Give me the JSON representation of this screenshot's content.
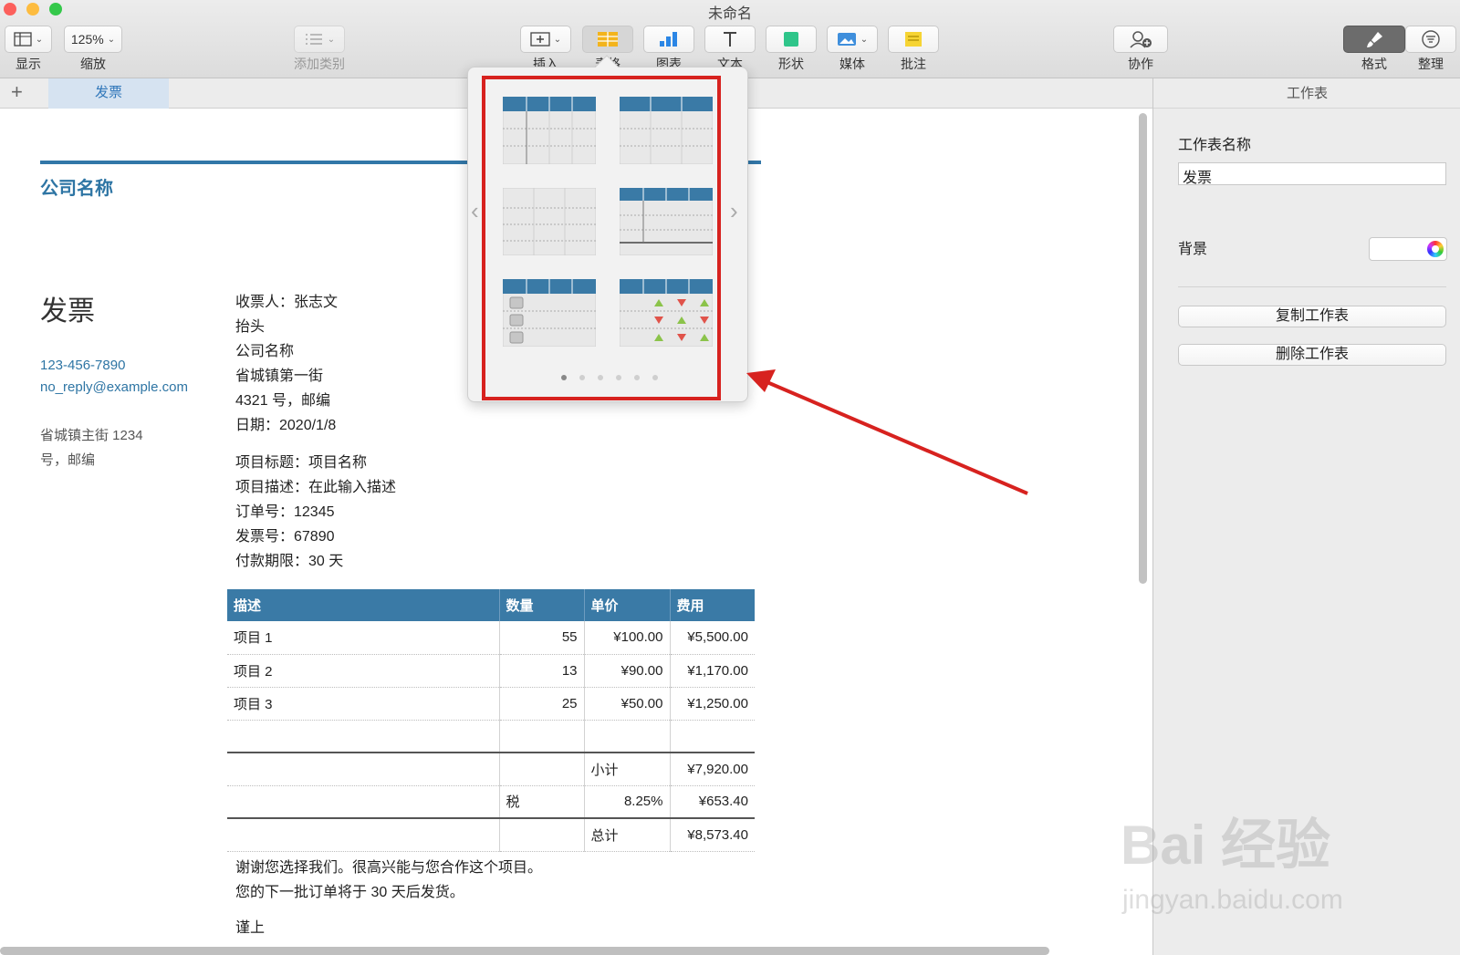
{
  "window": {
    "title": "未命名"
  },
  "toolbar": {
    "view": {
      "label": "显示",
      "icon": "sidebar-icon"
    },
    "zoom": {
      "label": "缩放",
      "value": "125%"
    },
    "category": {
      "label": "添加类别",
      "icon": "list-icon"
    },
    "insert": {
      "label": "插入",
      "icon": "insert-icon"
    },
    "table": {
      "label": "表格",
      "icon": "table-icon"
    },
    "chart": {
      "label": "图表",
      "icon": "bar-chart-icon"
    },
    "text": {
      "label": "文本",
      "icon": "text-icon"
    },
    "shape": {
      "label": "形状",
      "icon": "shape-icon"
    },
    "media": {
      "label": "媒体",
      "icon": "image-icon"
    },
    "comment": {
      "label": "批注",
      "icon": "comment-icon"
    },
    "collaborate": {
      "label": "协作",
      "icon": "collaborate-icon"
    },
    "format": {
      "label": "格式",
      "icon": "paintbrush-icon"
    },
    "organize": {
      "label": "整理",
      "icon": "filter-icon"
    }
  },
  "tabs": {
    "add": "+",
    "active": "发票"
  },
  "document": {
    "company": "公司名称",
    "title": "发票",
    "phone": "123-456-7890",
    "email": "no_reply@example.com",
    "address": [
      "省城镇主街 1234",
      "号，邮编"
    ],
    "recipient_lines": [
      "收票人：张志文",
      "抬头",
      "公司名称",
      "省城镇第一街",
      "4321 号，邮编",
      "日期：2020/1/8"
    ],
    "project_lines": [
      "项目标题：项目名称",
      "项目描述：在此输入描述",
      "订单号：12345",
      "发票号：67890",
      "付款期限：30 天"
    ],
    "table": {
      "headers": [
        "描述",
        "数量",
        "单价",
        "费用"
      ],
      "rows": [
        [
          "项目 1",
          "55",
          "¥100.00",
          "¥5,500.00"
        ],
        [
          "项目 2",
          "13",
          "¥90.00",
          "¥1,170.00"
        ],
        [
          "项目 3",
          "25",
          "¥50.00",
          "¥1,250.00"
        ],
        [
          "",
          "",
          "",
          ""
        ]
      ],
      "subtotal_label": "小计",
      "subtotal": "¥7,920.00",
      "tax_label": "税",
      "tax_rate": "8.25%",
      "tax": "¥653.40",
      "total_label": "总计",
      "total": "¥8,573.40"
    },
    "footer_lines": [
      "谢谢您选择我们。很高兴能与您合作这个项目。",
      "您的下一批订单将于 30 天后发货。",
      "谨上"
    ]
  },
  "sidebar": {
    "title": "工作表",
    "name_label": "工作表名称",
    "name_value": "发票",
    "background_label": "背景",
    "duplicate": "复制工作表",
    "delete": "删除工作表"
  },
  "popover": {
    "page_count": 6,
    "current_page": 1
  },
  "colors": {
    "accent": "#3a7aa6",
    "highlight": "#d7221f",
    "table_orange": "#f3b41c"
  },
  "watermark": {
    "main": "Bai 经验",
    "sub": "jingyan.baidu.com"
  }
}
